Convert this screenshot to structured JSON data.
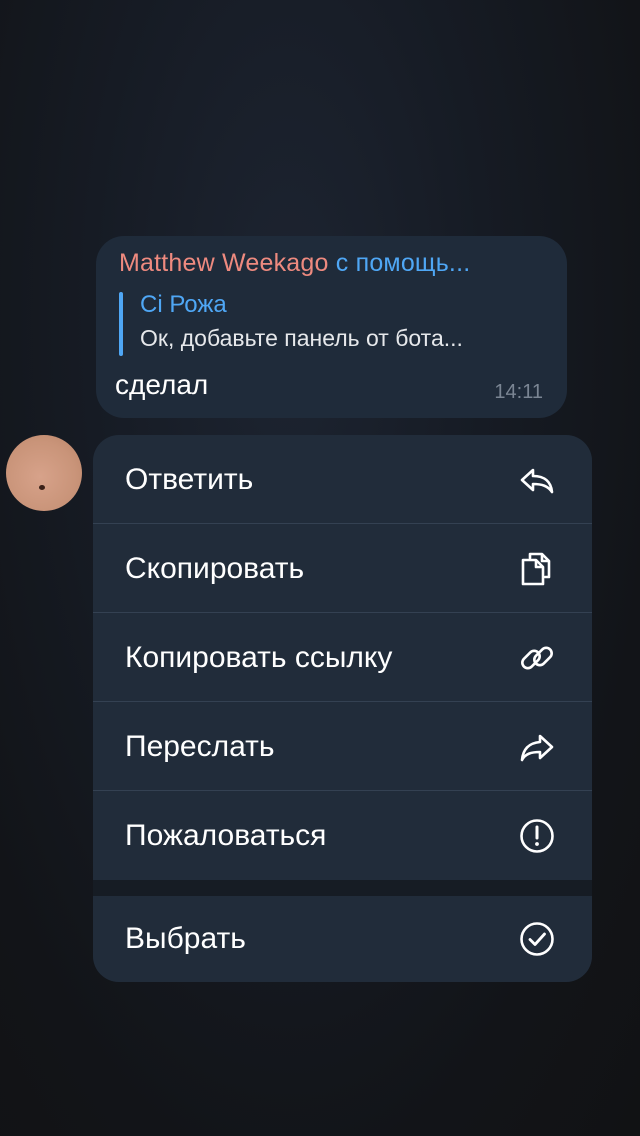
{
  "message": {
    "sender_name": "Matthew Weekago",
    "via_bot": "с помощь...",
    "reply_author": "Сі Рожа",
    "reply_text": "Ок, добавьте панель от бота...",
    "text": "сделал",
    "time": "14:11"
  },
  "menu": {
    "items": [
      {
        "label": "Ответить",
        "icon": "reply-icon"
      },
      {
        "label": "Скопировать",
        "icon": "copy-icon"
      },
      {
        "label": "Копировать ссылку",
        "icon": "link-icon"
      },
      {
        "label": "Переслать",
        "icon": "forward-icon"
      },
      {
        "label": "Пожаловаться",
        "icon": "report-icon"
      },
      {
        "label": "Выбрать",
        "icon": "select-check-icon"
      }
    ]
  },
  "colors": {
    "sender_name": "#ee8a7f",
    "accent": "#4fa7f5",
    "bubble": "#1f2b3a",
    "menu_item": "#212c3a"
  }
}
